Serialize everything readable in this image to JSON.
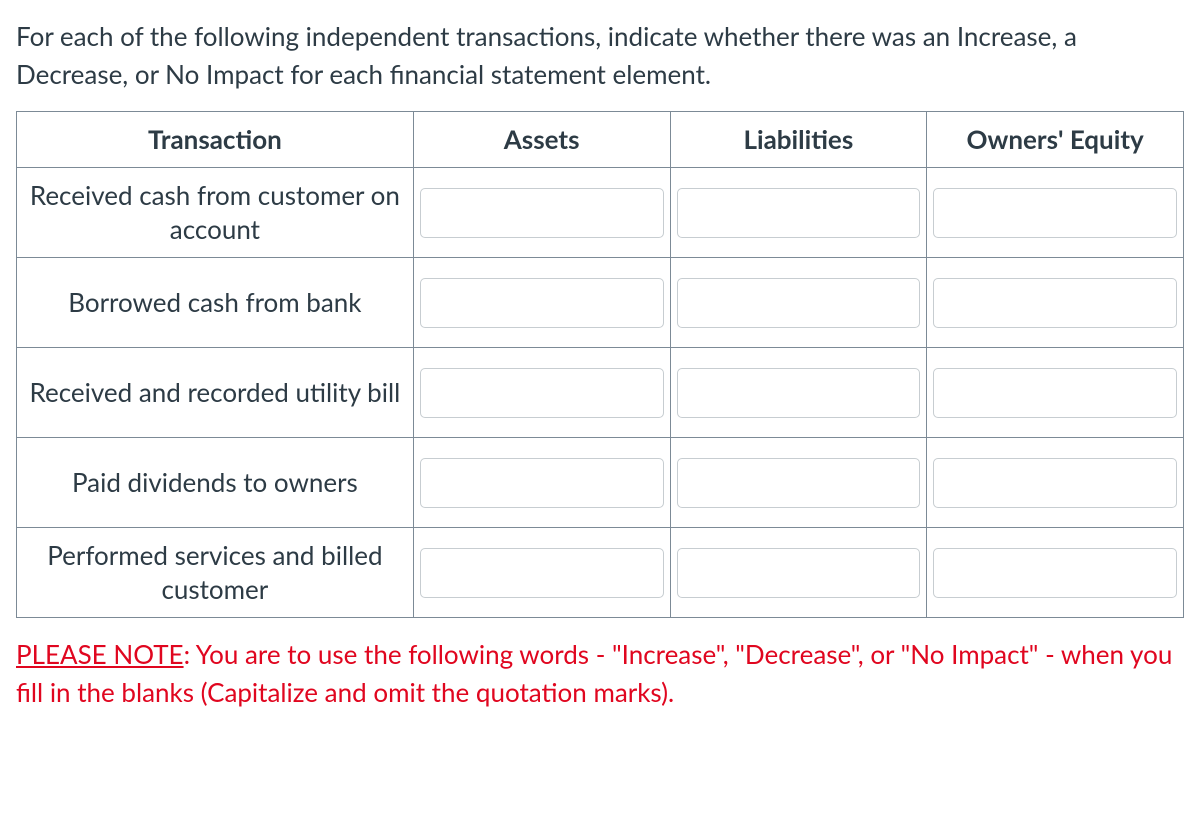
{
  "instructions": "For each of the following independent transactions, indicate whether there was an Increase, a Decrease, or No Impact for each financial statement element.",
  "headers": {
    "transaction": "Transaction",
    "assets": "Assets",
    "liabilities": "Liabilities",
    "owners_equity": "Owners' Equity"
  },
  "rows": [
    {
      "transaction": "Received cash from customer on account",
      "assets": "",
      "liabilities": "",
      "owners_equity": ""
    },
    {
      "transaction": "Borrowed cash from bank",
      "assets": "",
      "liabilities": "",
      "owners_equity": ""
    },
    {
      "transaction": "Received and recorded utility bill",
      "assets": "",
      "liabilities": "",
      "owners_equity": ""
    },
    {
      "transaction": "Paid dividends to owners",
      "assets": "",
      "liabilities": "",
      "owners_equity": ""
    },
    {
      "transaction": "Performed services and billed customer",
      "assets": "",
      "liabilities": "",
      "owners_equity": ""
    }
  ],
  "note": {
    "label": "PLEASE NOTE",
    "text": ": You are to use the following words - \"Increase\", \"Decrease\", or \"No Impact\" - when you fill in the blanks (Capitalize and omit the quotation marks)."
  }
}
